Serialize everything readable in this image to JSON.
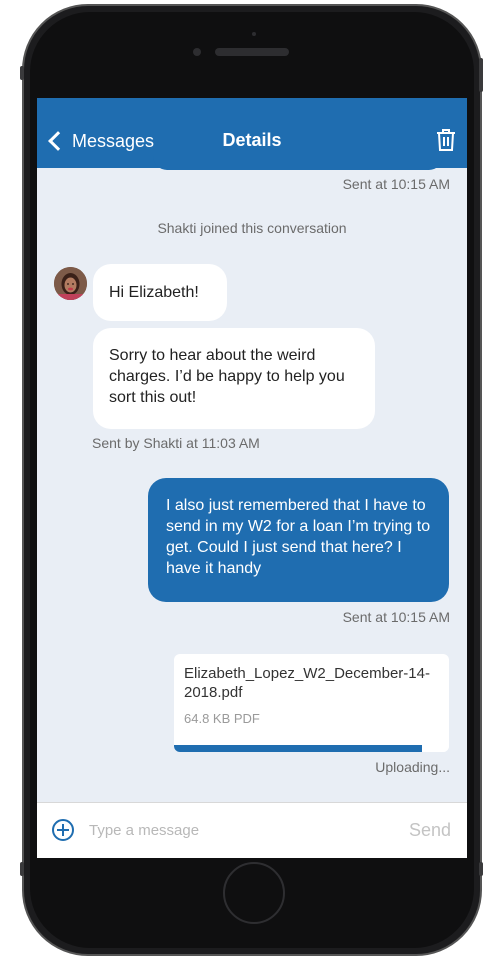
{
  "nav": {
    "back_label": "Messages",
    "title": "Details"
  },
  "conversation": {
    "prev_sent_status": "Sent at 10:15 AM",
    "system_notice": "Shakti joined this conversation",
    "incoming": [
      "Hi Elizabeth!",
      "Sorry to hear about the weird charges. I’d be happy to help you sort this out!"
    ],
    "incoming_status": "Sent by Shakti at 11:03 AM",
    "outgoing": "I also just remembered that I have to send in my W2 for a loan I’m trying to get. Could I just send that here? I have it handy",
    "outgoing_status": "Sent at 10:15 AM",
    "attachment": {
      "file_name": "Elizabeth_Lopez_W2_December-14-2018.pdf",
      "file_info": "64.8 KB PDF",
      "progress": 0.9,
      "status": "Uploading..."
    }
  },
  "composer": {
    "placeholder": "Type a message",
    "send_label": "Send"
  },
  "colors": {
    "brand": "#1f6db0",
    "background": "#e9eef5"
  },
  "icons": [
    "chevron-left-icon",
    "trash-icon",
    "plus-circle-icon"
  ]
}
